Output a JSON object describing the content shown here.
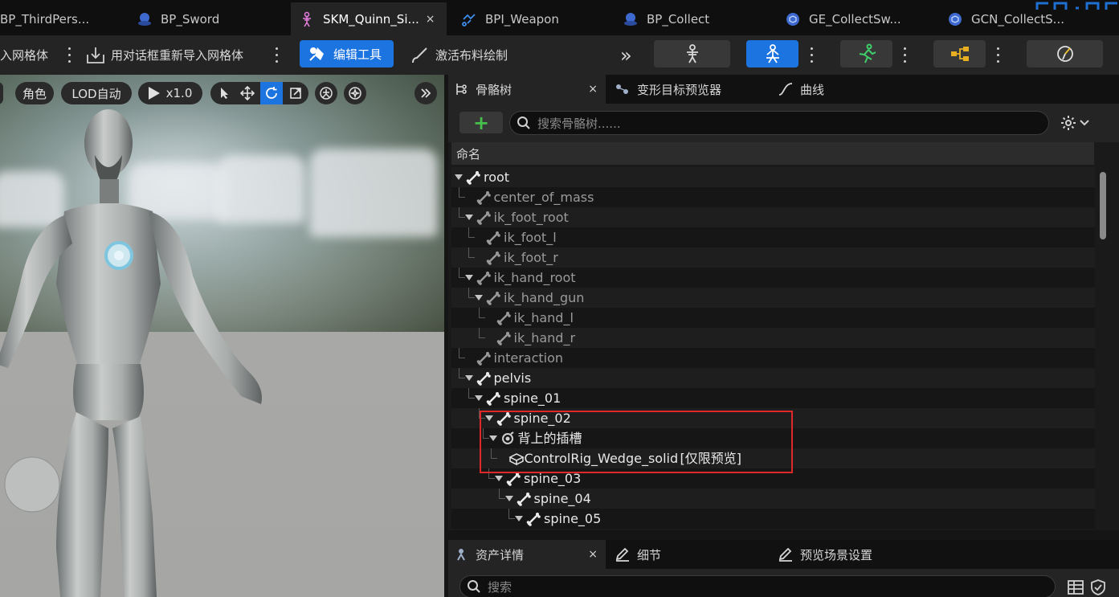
{
  "tabs": [
    {
      "label": "BP_ThirdPers...",
      "icon": "blueprint-icon"
    },
    {
      "label": "BP_Sword",
      "icon": "blueprint-icon"
    },
    {
      "label": "SKM_Quinn_Si...",
      "icon": "skeletal-mesh-icon",
      "active": true,
      "close": "×"
    },
    {
      "label": "BPI_Weapon",
      "icon": "interface-icon"
    },
    {
      "label": "BP_Collect",
      "icon": "blueprint-icon"
    },
    {
      "label": "GE_CollectSw...",
      "icon": "gameplay-effect-icon"
    },
    {
      "label": "GCN_CollectS...",
      "icon": "gameplay-cue-icon"
    }
  ],
  "toolbar": {
    "import_mesh": "入网格体",
    "reimport_dialog": "用对话框重新导入网格体",
    "edit_tools": "编辑工具",
    "activate_cloth": "激活布料绘制",
    "more": "»"
  },
  "viewport": {
    "character_chip": "角色",
    "lod_chip": "LOD自动",
    "play_speed": "x1.0"
  },
  "skeleton_panel": {
    "tabs": {
      "skeleton_tree": "骨骼树",
      "close": "×",
      "morph_preview": "变形目标预览器",
      "curves": "曲线"
    },
    "add_label": "+",
    "search_placeholder": "搜索骨骼树......",
    "column_name": "命名",
    "bones": [
      {
        "name": "root",
        "depth": 0,
        "expanded": true,
        "dim": false
      },
      {
        "name": "center_of_mass",
        "depth": 1,
        "expanded": false,
        "dim": true
      },
      {
        "name": "ik_foot_root",
        "depth": 1,
        "expanded": true,
        "dim": true
      },
      {
        "name": "ik_foot_l",
        "depth": 2,
        "expanded": false,
        "dim": true
      },
      {
        "name": "ik_foot_r",
        "depth": 2,
        "expanded": false,
        "dim": true
      },
      {
        "name": "ik_hand_root",
        "depth": 1,
        "expanded": true,
        "dim": true
      },
      {
        "name": "ik_hand_gun",
        "depth": 2,
        "expanded": true,
        "dim": true
      },
      {
        "name": "ik_hand_l",
        "depth": 3,
        "expanded": false,
        "dim": true
      },
      {
        "name": "ik_hand_r",
        "depth": 3,
        "expanded": false,
        "dim": true
      },
      {
        "name": "interaction",
        "depth": 1,
        "expanded": false,
        "dim": true
      },
      {
        "name": "pelvis",
        "depth": 1,
        "expanded": true,
        "dim": false
      },
      {
        "name": "spine_01",
        "depth": 2,
        "expanded": true,
        "dim": false
      },
      {
        "name": "spine_02",
        "depth": 3,
        "expanded": true,
        "dim": false
      },
      {
        "name": "背上的插槽",
        "depth": 3.4,
        "expanded": true,
        "dim": false,
        "kind": "socket"
      },
      {
        "name": "ControlRig_Wedge_solid",
        "suffix": "[仅限预览]",
        "depth": 4.2,
        "expanded": false,
        "dim": false,
        "kind": "mesh"
      },
      {
        "name": "spine_03",
        "depth": 4,
        "expanded": true,
        "dim": false
      },
      {
        "name": "spine_04",
        "depth": 5,
        "expanded": true,
        "dim": false
      },
      {
        "name": "spine_05",
        "depth": 6,
        "expanded": true,
        "dim": false
      }
    ]
  },
  "details_panel": {
    "tabs": {
      "asset_details": "资产详情",
      "close": "×",
      "details": "细节",
      "preview_scene": "预览场景设置"
    },
    "search_placeholder": "搜索"
  },
  "colors": {
    "accent": "#1c74e0",
    "highlight_border": "#e02828"
  }
}
